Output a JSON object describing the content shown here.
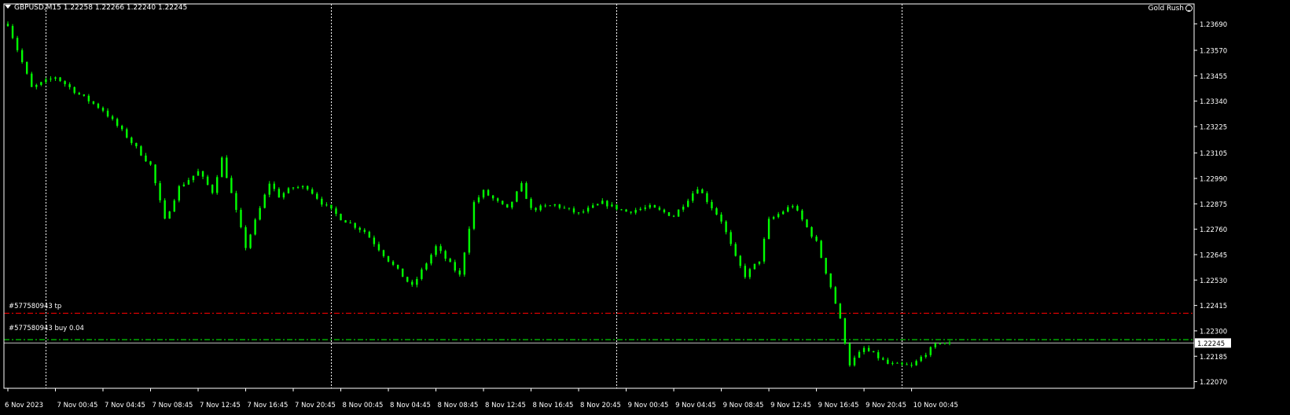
{
  "header": {
    "symbol_info": "GBPUSD,M15  1.22258 1.22266 1.22240 1.22245",
    "expert_advisor": "Gold Rush"
  },
  "colors": {
    "background": "#000000",
    "frame": "#ffffff",
    "candle": "#00ff00",
    "bid_line": "#ffffff",
    "tp_line": "#ff0000",
    "order_line": "#00ff00",
    "separator": "#ffffff",
    "text": "#ffffff"
  },
  "orders": {
    "tp_label": "#577580943 tp",
    "buy_label": "#577580943 buy 0.04"
  },
  "chart_data": {
    "type": "line",
    "symbol": "GBPUSD",
    "timeframe": "M15",
    "ohlc_last": {
      "open": 1.22258,
      "high": 1.22266,
      "low": 1.2224,
      "close": 1.22245
    },
    "current_price": 1.22245,
    "current_price_label": "1.22245",
    "ylim": [
      1.2204,
      1.2378
    ],
    "yticks": [
      {
        "value": 1.2369,
        "label": "1.23690"
      },
      {
        "value": 1.2357,
        "label": "1.23570"
      },
      {
        "value": 1.23455,
        "label": "1.23455"
      },
      {
        "value": 1.2334,
        "label": "1.23340"
      },
      {
        "value": 1.23225,
        "label": "1.23225"
      },
      {
        "value": 1.23105,
        "label": "1.23105"
      },
      {
        "value": 1.2299,
        "label": "1.22990"
      },
      {
        "value": 1.22875,
        "label": "1.22875"
      },
      {
        "value": 1.2276,
        "label": "1.22760"
      },
      {
        "value": 1.22645,
        "label": "1.22645"
      },
      {
        "value": 1.2253,
        "label": "1.22530"
      },
      {
        "value": 1.22415,
        "label": "1.22415"
      },
      {
        "value": 1.223,
        "label": "1.22300"
      },
      {
        "value": 1.22185,
        "label": "1.22185"
      },
      {
        "value": 1.2207,
        "label": "1.22070"
      }
    ],
    "xlim": [
      0,
      254
    ],
    "xticks": [
      {
        "bar": 0,
        "label": "6 Nov 2023"
      },
      {
        "bar": 10,
        "label": "7 Nov 00:45"
      },
      {
        "bar": 20,
        "label": "7 Nov 04:45"
      },
      {
        "bar": 30,
        "label": "7 Nov 08:45"
      },
      {
        "bar": 40,
        "label": "7 Nov 12:45"
      },
      {
        "bar": 50,
        "label": "7 Nov 16:45"
      },
      {
        "bar": 60,
        "label": "7 Nov 20:45"
      },
      {
        "bar": 70,
        "label": "8 Nov 00:45"
      },
      {
        "bar": 80,
        "label": "8 Nov 04:45"
      },
      {
        "bar": 90,
        "label": "8 Nov 08:45"
      },
      {
        "bar": 100,
        "label": "8 Nov 12:45"
      },
      {
        "bar": 110,
        "label": "8 Nov 16:45"
      },
      {
        "bar": 120,
        "label": "8 Nov 20:45"
      },
      {
        "bar": 130,
        "label": "9 Nov 00:45"
      },
      {
        "bar": 140,
        "label": "9 Nov 04:45"
      },
      {
        "bar": 150,
        "label": "9 Nov 08:45"
      },
      {
        "bar": 160,
        "label": "9 Nov 12:45"
      },
      {
        "bar": 170,
        "label": "9 Nov 16:45"
      },
      {
        "bar": 180,
        "label": "9 Nov 20:45"
      },
      {
        "bar": 190,
        "label": "10 Nov 00:45"
      }
    ],
    "day_separators": [
      8,
      68,
      128,
      188
    ],
    "levels": [
      {
        "name": "tp",
        "value": 1.2238
      },
      {
        "name": "buy",
        "value": 1.2226
      },
      {
        "name": "bid",
        "value": 1.22245
      }
    ],
    "series": [
      {
        "x": [
          0,
          5,
          10,
          15,
          20,
          25,
          30,
          33,
          36,
          40,
          43,
          45,
          50,
          55,
          57,
          60,
          63,
          66,
          70,
          75,
          80,
          85,
          90,
          95,
          98,
          100,
          105,
          108,
          110,
          115,
          120,
          125,
          130,
          135,
          140,
          145,
          150,
          153,
          155,
          158,
          160,
          165,
          170,
          173,
          175,
          177,
          180,
          183,
          185,
          190,
          193,
          196,
          198
        ],
        "y": [
          1.2369,
          1.234,
          1.2345,
          1.2337,
          1.233,
          1.2318,
          1.2305,
          1.228,
          1.2295,
          1.2302,
          1.2293,
          1.2308,
          1.2268,
          1.2297,
          1.2291,
          1.2295,
          1.2295,
          1.2288,
          1.2281,
          1.2275,
          1.2262,
          1.225,
          1.2268,
          1.2255,
          1.2288,
          1.2293,
          1.2285,
          1.2296,
          1.2285,
          1.2287,
          1.2283,
          1.2288,
          1.2284,
          1.2286,
          1.2282,
          1.2295,
          1.228,
          1.2263,
          1.2255,
          1.2262,
          1.228,
          1.2287,
          1.227,
          1.225,
          1.2235,
          1.2215,
          1.2222,
          1.2218,
          1.2215,
          1.2214,
          1.222,
          1.2225,
          1.22245
        ]
      }
    ]
  }
}
